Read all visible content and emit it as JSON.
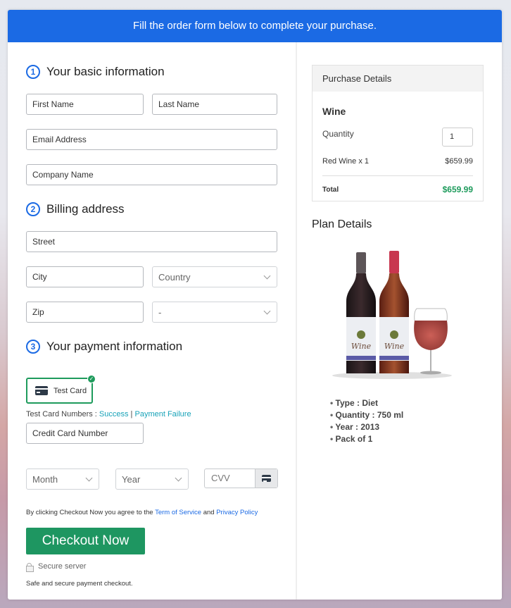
{
  "banner": {
    "text": "Fill the order form below to complete your purchase."
  },
  "basic_info": {
    "step": "1",
    "title": "Your basic information",
    "fields": {
      "first_name": "First Name",
      "last_name": "Last Name",
      "email": "Email Address",
      "company": "Company Name"
    }
  },
  "billing": {
    "step": "2",
    "title": "Billing address",
    "fields": {
      "street": "Street",
      "city": "City",
      "country": "Country",
      "zip": "Zip",
      "state": "-"
    }
  },
  "payment": {
    "step": "3",
    "title": "Your payment information",
    "method_label": "Test Card",
    "test_numbers_label": "Test Card Numbers : ",
    "success_link": "Success",
    "separator": " | ",
    "failure_link": "Payment Failure",
    "card_number": "Credit Card Number",
    "month": "Month",
    "year": "Year",
    "cvv": "CVV"
  },
  "agreement": {
    "prefix": "By clicking Checkout Now you agree to the ",
    "tos": "Term of Service",
    "and": " and ",
    "privacy": "Privacy Policy"
  },
  "checkout_button": "Checkout Now",
  "secure_server": "Secure server",
  "safe_text": "Safe and secure payment checkout.",
  "purchase": {
    "title": "Purchase Details",
    "product": "Wine",
    "quantity_label": "Quantity",
    "quantity_value": "1",
    "line_item": "Red Wine x 1",
    "line_price": "$659.99",
    "total_label": "Total",
    "total_price": "$659.99",
    "total_color": "#1e9b5c"
  },
  "plan": {
    "title": "Plan Details",
    "bottle_labels": [
      "Wine",
      "Wine"
    ],
    "features": [
      "Type : Diet",
      "Quantity : 750 ml",
      "Year : 2013",
      "Pack of 1"
    ]
  },
  "colors": {
    "primary": "#1b6ae4",
    "success": "#1e9661",
    "link": "#17a2b8"
  }
}
